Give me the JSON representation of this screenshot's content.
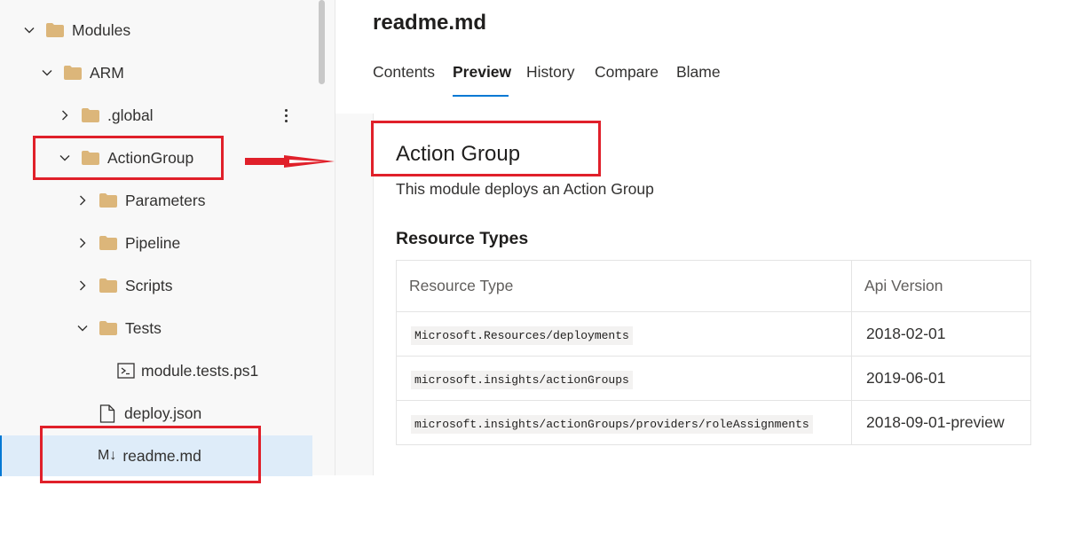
{
  "sidebar": {
    "items": [
      {
        "label": "Modules",
        "type": "folder",
        "chevron": "down"
      },
      {
        "label": "ARM",
        "type": "folder",
        "chevron": "down"
      },
      {
        "label": ".global",
        "type": "folder",
        "chevron": "right"
      },
      {
        "label": "ActionGroup",
        "type": "folder",
        "chevron": "down"
      },
      {
        "label": "Parameters",
        "type": "folder",
        "chevron": "right"
      },
      {
        "label": "Pipeline",
        "type": "folder",
        "chevron": "right"
      },
      {
        "label": "Scripts",
        "type": "folder",
        "chevron": "right"
      },
      {
        "label": "Tests",
        "type": "folder",
        "chevron": "down"
      },
      {
        "label": "module.tests.ps1",
        "type": "script-file"
      },
      {
        "label": "deploy.json",
        "type": "file"
      },
      {
        "label": "readme.md",
        "type": "markdown-file",
        "prefix": "M↓",
        "selected": true
      }
    ]
  },
  "header": {
    "file_title": "readme.md",
    "tabs": [
      "Contents",
      "Preview",
      "History",
      "Compare",
      "Blame"
    ],
    "active_tab": "Preview"
  },
  "preview": {
    "heading": "Action Group",
    "description": "This module deploys an Action Group",
    "section_heading": "Resource Types",
    "table": {
      "headers": [
        "Resource Type",
        "Api Version"
      ],
      "rows": [
        [
          "Microsoft.Resources/deployments",
          "2018-02-01"
        ],
        [
          "microsoft.insights/actionGroups",
          "2019-06-01"
        ],
        [
          "microsoft.insights/actionGroups/providers/roleAssignments",
          "2018-09-01-preview"
        ]
      ]
    }
  },
  "colors": {
    "annotation_red": "#e0202a",
    "accent_blue": "#0078d4",
    "selected_bg": "#deecf9",
    "folder": "#dcb67a"
  }
}
